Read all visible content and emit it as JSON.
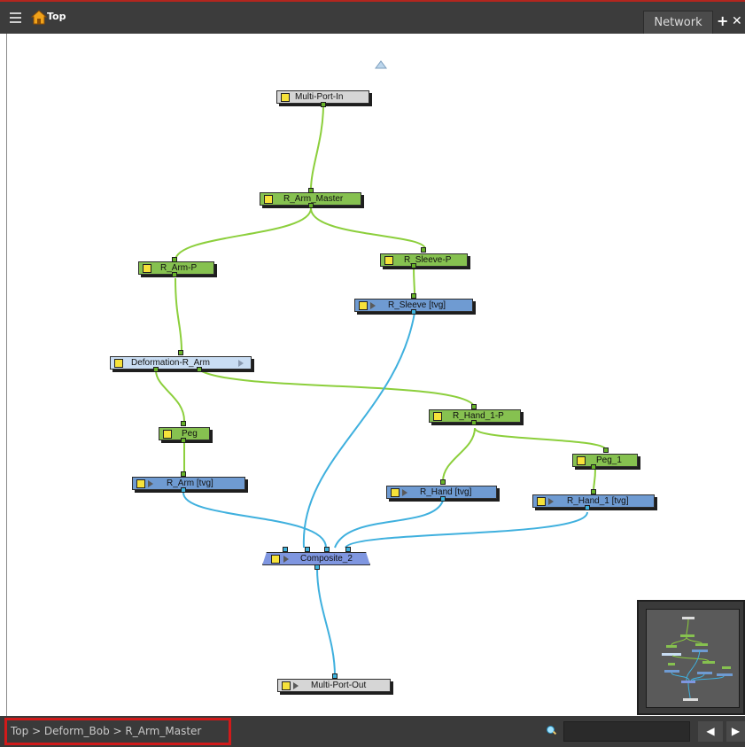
{
  "titlebar": {
    "path_label": "Top",
    "tab_label": "Network",
    "add_icon": "+",
    "close_icon": "✕"
  },
  "nodes": {
    "multi_port_in": "Multi-Port-In",
    "r_arm_master": "R_Arm_Master",
    "r_arm_p": "R_Arm-P",
    "r_sleeve_p": "R_Sleeve-P",
    "r_sleeve": "R_Sleeve [tvg]",
    "deformation_r_arm": "Deformation-R_Arm",
    "r_hand_1_p": "R_Hand_1-P",
    "peg": "Peg",
    "peg_1": "Peg_1",
    "r_arm": "R_Arm [tvg]",
    "r_hand": "R_Hand [tvg]",
    "r_hand_1": "R_Hand_1 [tvg]",
    "composite_2": "Composite_2",
    "multi_port_out": "Multi-Port-Out"
  },
  "statusbar": {
    "breadcrumb": "Top  >  Deform_Bob  >  R_Arm_Master",
    "search_value": "",
    "prev_icon": "◀",
    "next_icon": "▶"
  },
  "colors": {
    "peg_wire": "#8ccf3c",
    "image_wire": "#3fb0de",
    "green_node": "#86c150",
    "blue_node": "#6f9bd2"
  },
  "icons": [
    "menu-icon",
    "home-icon",
    "add-icon",
    "close-icon",
    "search-icon",
    "arrow-up-icon",
    "prev-icon",
    "next-icon"
  ]
}
